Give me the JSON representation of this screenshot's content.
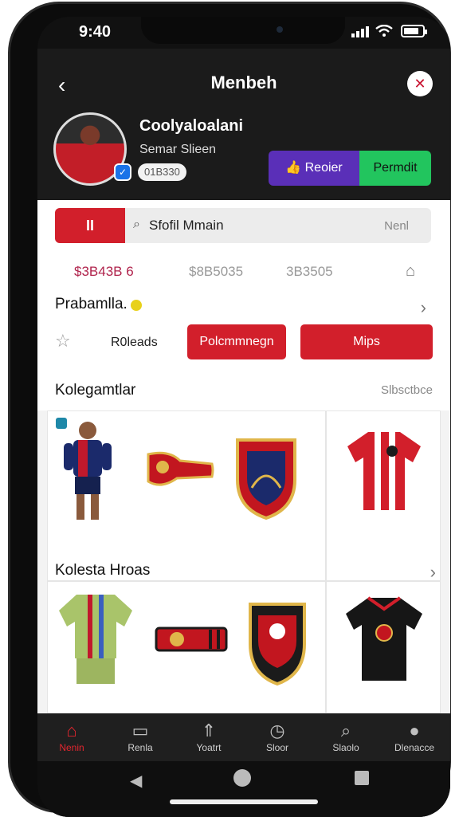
{
  "status": {
    "time": "9:40"
  },
  "header": {
    "title": "Menbeh",
    "back_icon": "chevron-left-icon",
    "logo_icon": "club-logo-icon",
    "profile": {
      "name": "Coolyaloalani",
      "subtitle": "Semar Slieen",
      "badge": "01B330",
      "verified_icon": "verified-icon"
    },
    "buttons": {
      "primary": "Reoier",
      "secondary": "Permdit"
    },
    "colors": {
      "header_bg": "#1b1b1b",
      "purple": "#5a2fb8",
      "green": "#22c55e"
    }
  },
  "tabs": {
    "active_glyph": "II",
    "search_label": "Sfofil Mmain",
    "next_label": "Nenl"
  },
  "prices": {
    "p1": "$3B43B 6",
    "p2": "$8B5035",
    "p3": "3B3505",
    "p4_icon": "tag-icon"
  },
  "profile_row": {
    "label": "Prabamlla.",
    "chevron": "›"
  },
  "actions": {
    "reloads_label": "R0leads",
    "btn1": "Polcmmnegn",
    "btn2": "Mips"
  },
  "section": {
    "title": "Kolegamtlar",
    "action": "Slbsctbce"
  },
  "grid": {
    "title": "Kolesta Hroas",
    "chevron": "›",
    "accent": "#d21f2b"
  },
  "nav": {
    "items": [
      {
        "label": "Nenin",
        "icon": "home-icon",
        "active": true
      },
      {
        "label": "Renla",
        "icon": "monitor-icon"
      },
      {
        "label": "Yoatrt",
        "icon": "tower-icon"
      },
      {
        "label": "Sloor",
        "icon": "clock-icon"
      },
      {
        "label": "Slaolo",
        "icon": "search-icon"
      },
      {
        "label": "Dlenacce",
        "icon": "profile-icon"
      }
    ]
  }
}
